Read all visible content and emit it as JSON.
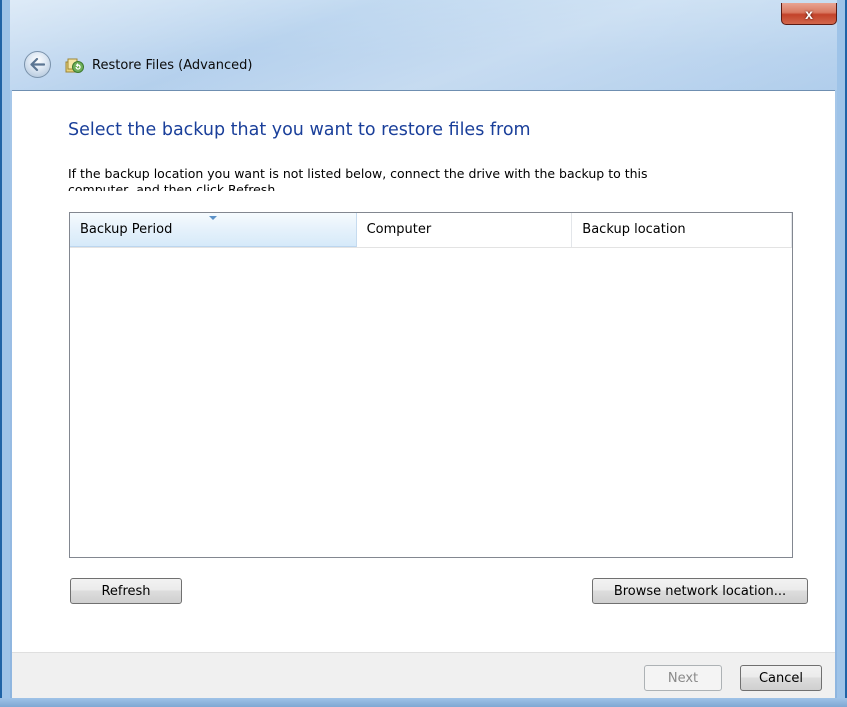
{
  "window": {
    "title": "Restore Files (Advanced)",
    "close_label": "x"
  },
  "main": {
    "heading": "Select the backup that you want to restore files from",
    "description_line1": "If the backup location you want is not listed below, connect the drive with the backup to this",
    "description_line2": "computer, and then click Refresh.",
    "list": {
      "columns": [
        "Backup Period",
        "Computer",
        "Backup location"
      ],
      "sorted_column": "Backup Period",
      "rows": []
    },
    "refresh_label": "Refresh",
    "browse_label": "Browse network location..."
  },
  "footer": {
    "next_label": "Next",
    "next_enabled": false,
    "cancel_label": "Cancel"
  },
  "colors": {
    "heading": "#1a3f9a",
    "glass": "#a9c9ea",
    "close_button": "#c2422a"
  },
  "icons": {
    "back": "back-arrow-icon",
    "title": "restore-files-icon",
    "close": "close-icon",
    "sort": "sort-indicator-icon"
  }
}
